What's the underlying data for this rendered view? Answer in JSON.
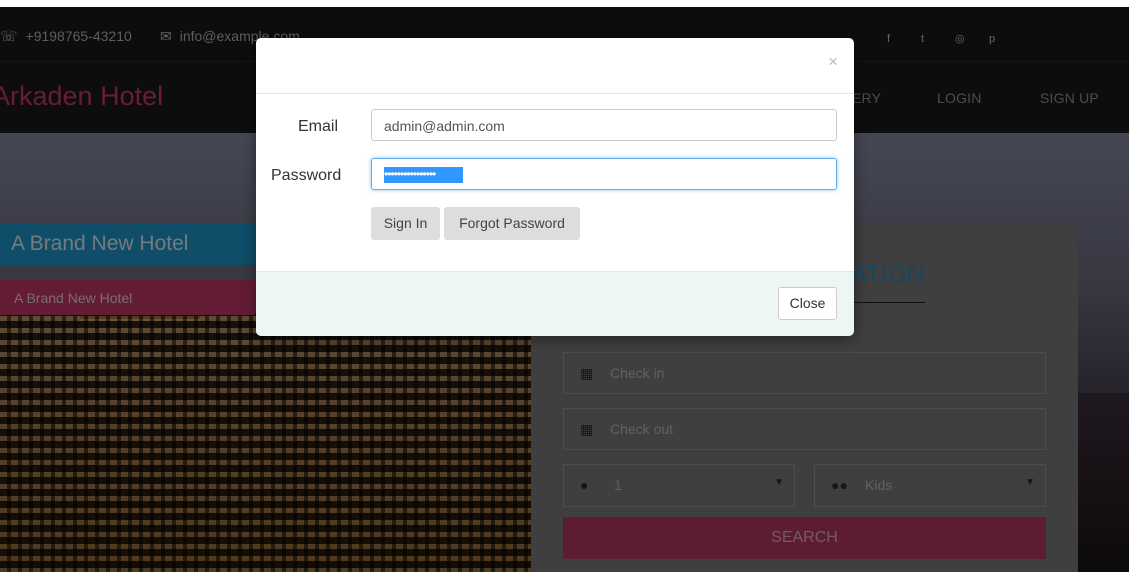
{
  "topbar": {
    "phone_icon": "phone-icon",
    "phone": "+9198765-43210",
    "mail_icon": "envelope-icon",
    "email": "info@example.com",
    "socials": [
      "f",
      "t",
      "◎",
      "p"
    ]
  },
  "nav": {
    "brand": "Arkaden Hotel",
    "items": [
      "ERY",
      "LOGIN",
      "SIGN UP"
    ]
  },
  "hero": {
    "band_title": "A Brand New Hotel",
    "band_sub": "A Brand New Hotel"
  },
  "booking": {
    "title": "ATION",
    "check_in": "Check in",
    "check_out": "Check out",
    "adults": "1",
    "kids": "Kids",
    "search": "SEARCH"
  },
  "modal": {
    "close_x": "×",
    "email_label": "Email",
    "email_value": "admin@admin.com",
    "password_label": "Password",
    "password_mask": "••••••••••••••••",
    "signin": "Sign In",
    "forgot": "Forgot Password",
    "close": "Close"
  },
  "colors": {
    "brand": "#d0386f",
    "accent_blue": "#1f9ad1",
    "search_pink": "#b83864"
  }
}
